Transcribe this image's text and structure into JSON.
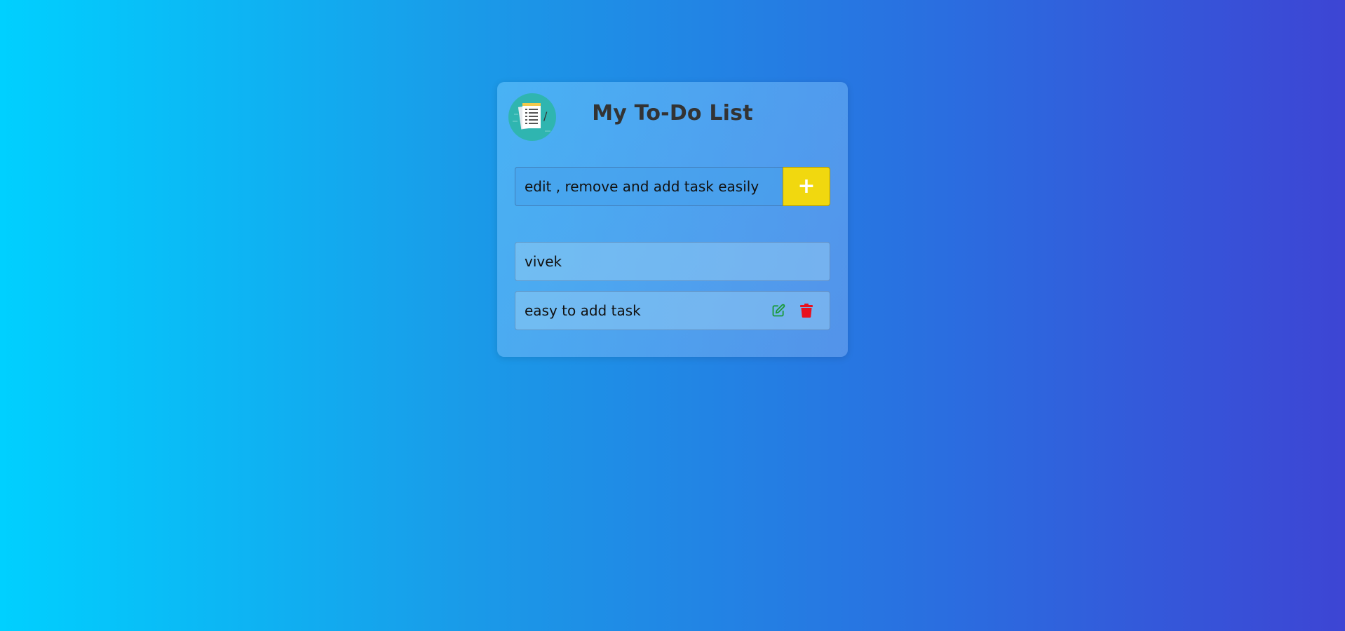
{
  "app": {
    "title": "My To-Do List",
    "logo_slash": "/"
  },
  "input": {
    "value": "edit , remove and add task easily",
    "placeholder": "edit , remove and add task easily",
    "add_label": "+"
  },
  "tasks": [
    {
      "text": "vivek",
      "show_actions": false
    },
    {
      "text": "easy to add task",
      "show_actions": true
    }
  ],
  "icons": {
    "logo": "notepad-icon",
    "edit": "edit-icon",
    "delete": "trash-icon"
  },
  "colors": {
    "add_button": "#f1d80f",
    "edit_icon": "#1a9a3a",
    "delete_icon": "#e8101e",
    "logo_bg": "#2fb5b0",
    "title": "#333333"
  }
}
